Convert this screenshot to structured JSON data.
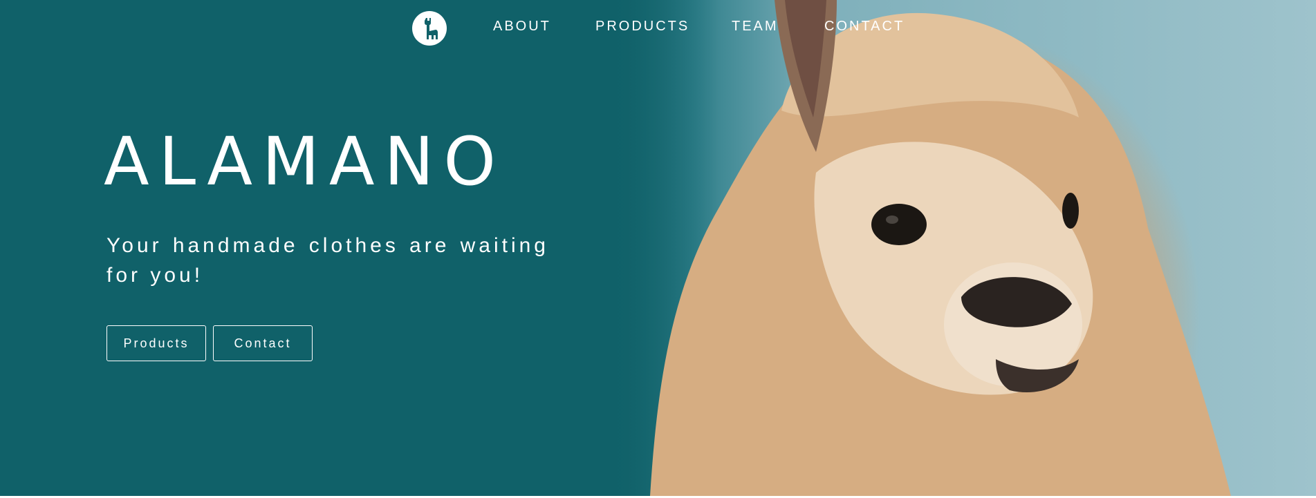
{
  "brand": {
    "logo_icon": "llama-icon",
    "title": "ALAMANO"
  },
  "nav": {
    "items": [
      {
        "label": "ABOUT"
      },
      {
        "label": "PRODUCTS"
      },
      {
        "label": "TEAM"
      },
      {
        "label": "CONTACT"
      }
    ]
  },
  "hero": {
    "tagline": "Your handmade clothes are waiting for you!",
    "buttons": [
      {
        "label": "Products"
      },
      {
        "label": "Contact"
      }
    ],
    "image": "alpaca-photo"
  },
  "colors": {
    "hero_background": "#106169",
    "text": "#ffffff",
    "sky": "#9ec3cc",
    "fleece": "#d9b38a"
  }
}
